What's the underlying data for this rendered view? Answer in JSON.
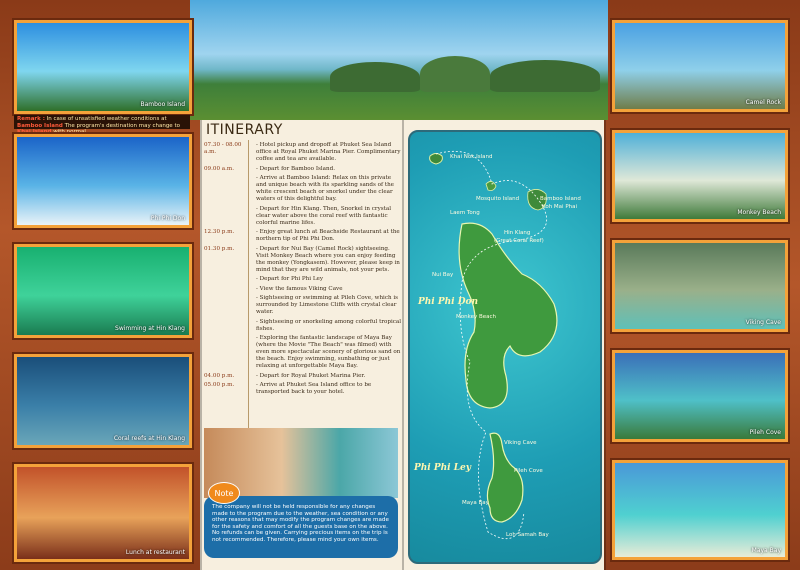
{
  "left_photos": [
    {
      "caption": "Bamboo Island",
      "colors": [
        "#2d8fe0",
        "#7fd6ef",
        "#2f6f2a"
      ]
    },
    {
      "caption": "Phi Phi Don",
      "colors": [
        "#1b64c8",
        "#59b3e6",
        "#e9f3f8"
      ]
    },
    {
      "caption": "Swimming at Hin Klang",
      "colors": [
        "#18b070",
        "#3fd29a",
        "#1a7b50"
      ]
    },
    {
      "caption": "Coral reefs at Hin Klang",
      "colors": [
        "#1a4e7a",
        "#3a7fa8",
        "#6aa6b8"
      ]
    },
    {
      "caption": "Lunch at restaurant",
      "colors": [
        "#c2522a",
        "#e8a25a",
        "#7a2f1a"
      ]
    }
  ],
  "remark": {
    "label": "Remark :",
    "text_a": "In case of unsatisfied weather conditions at",
    "highlight_a": "Bamboo Island",
    "text_b": "The program's destination may change to",
    "highlight_b": "Khai Island",
    "text_c": "with normal."
  },
  "itinerary": {
    "title": "ITINERARY",
    "rows": [
      {
        "time": "07.30 - 08.00 a.m.",
        "text": "- Hotel pickup and dropoff at Phuket Sea Island office at Royal Phuket Marina Pier. Complimentary coffee and tea are available."
      },
      {
        "time": "09.00 a.m.",
        "text": "- Depart for Bamboo Island."
      },
      {
        "time": "",
        "text": "- Arrive at Bamboo Island: Relax on this private and unique beach with its sparkling sands of the white crescent beach or snorkel under the clear waters of this delightful bay."
      },
      {
        "time": "",
        "text": "- Depart for Hin Klang. Then, Snorkel in crystal clear water above the coral reef with fantastic colorful marine lifes."
      },
      {
        "time": "12.30 p.m.",
        "text": "- Enjoy great lunch at Beachside Restaurant at the northern tip of Phi Phi Don."
      },
      {
        "time": "01.30 p.m.",
        "text": "- Depart for Nui Bay (Camel Rock) sightseeing. Visit Monkey Beach where you can enjoy feeding the monkey (Yongkasem). However, please keep in mind that they are wild animals, not your pets."
      },
      {
        "time": "",
        "text": "- Depart for Phi Phi Ley"
      },
      {
        "time": "",
        "text": "- View the famous Viking Cave"
      },
      {
        "time": "",
        "text": "- Sightseeing or swimming at Pileh Cove, which is surrounded by Limestone Cliffs with crystal clear water."
      },
      {
        "time": "",
        "text": "- Sightseeing or snorkeling among colorful tropical fishes."
      },
      {
        "time": "",
        "text": "- Exploring the fantastic landscape of Maya Bay (where the Movie \"The Beach\" was filmed) with even more spectacular scenery of glorious sand on the beach. Enjoy swimming, sunbathing or just relaxing at unforgettable Maya Bay."
      },
      {
        "time": "04.00 p.m.",
        "text": "- Depart for Royal Phuket Marina Pier."
      },
      {
        "time": "05.00 p.m.",
        "text": "- Arrive at Phuket Sea Island office to be transported back to your hotel."
      }
    ]
  },
  "note": {
    "badge": "Note",
    "text": "The company will not be held responsible for any changes made to the program due to the weather, sea condition or any other reasons that may modify the program changes are made for the safety and comfort of all the guests base on the above. No refunds can be given. Carrying precious items on the trip is not recommended. Therefore, please mind your own items."
  },
  "map": {
    "labels": {
      "khai_nok": "Khai Nok Island",
      "mosquito": "Mosquito Island",
      "bamboo": "Bamboo Island",
      "bamboo_sub": "Koh Mai Phai",
      "laem_tong": "Laem Tong",
      "hin_klang": "Hin Klang",
      "hin_klang_sub": "(Great Coral Reef)",
      "nui_bay": "Nui Bay",
      "monkey_beach": "Monkey Beach",
      "viking_cave": "Viking Cave",
      "pileh_cove": "Pileh Cove",
      "maya_bay": "Maya Bay",
      "loh_samah": "Loh Samah Bay"
    },
    "phi_phi_don": "Phi Phi Don",
    "phi_phi_ley": "Phi Phi Ley"
  },
  "right_photos": [
    {
      "caption": "Camel Rock",
      "colors": [
        "#4aa0e2",
        "#8fd0ea",
        "#6f7d4a"
      ]
    },
    {
      "caption": "Monkey Beach",
      "colors": [
        "#4fb0d8",
        "#dfe8d8",
        "#3f7a3a"
      ]
    },
    {
      "caption": "Viking Cave",
      "colors": [
        "#5a7a5a",
        "#9ab08a",
        "#5fc0b8"
      ]
    },
    {
      "caption": "Pileh Cove",
      "colors": [
        "#3a6fb8",
        "#4fc0c8",
        "#3a7a3a"
      ]
    },
    {
      "caption": "Maya Bay",
      "colors": [
        "#4a98d8",
        "#4fd0d0",
        "#e8ecd8"
      ]
    }
  ]
}
